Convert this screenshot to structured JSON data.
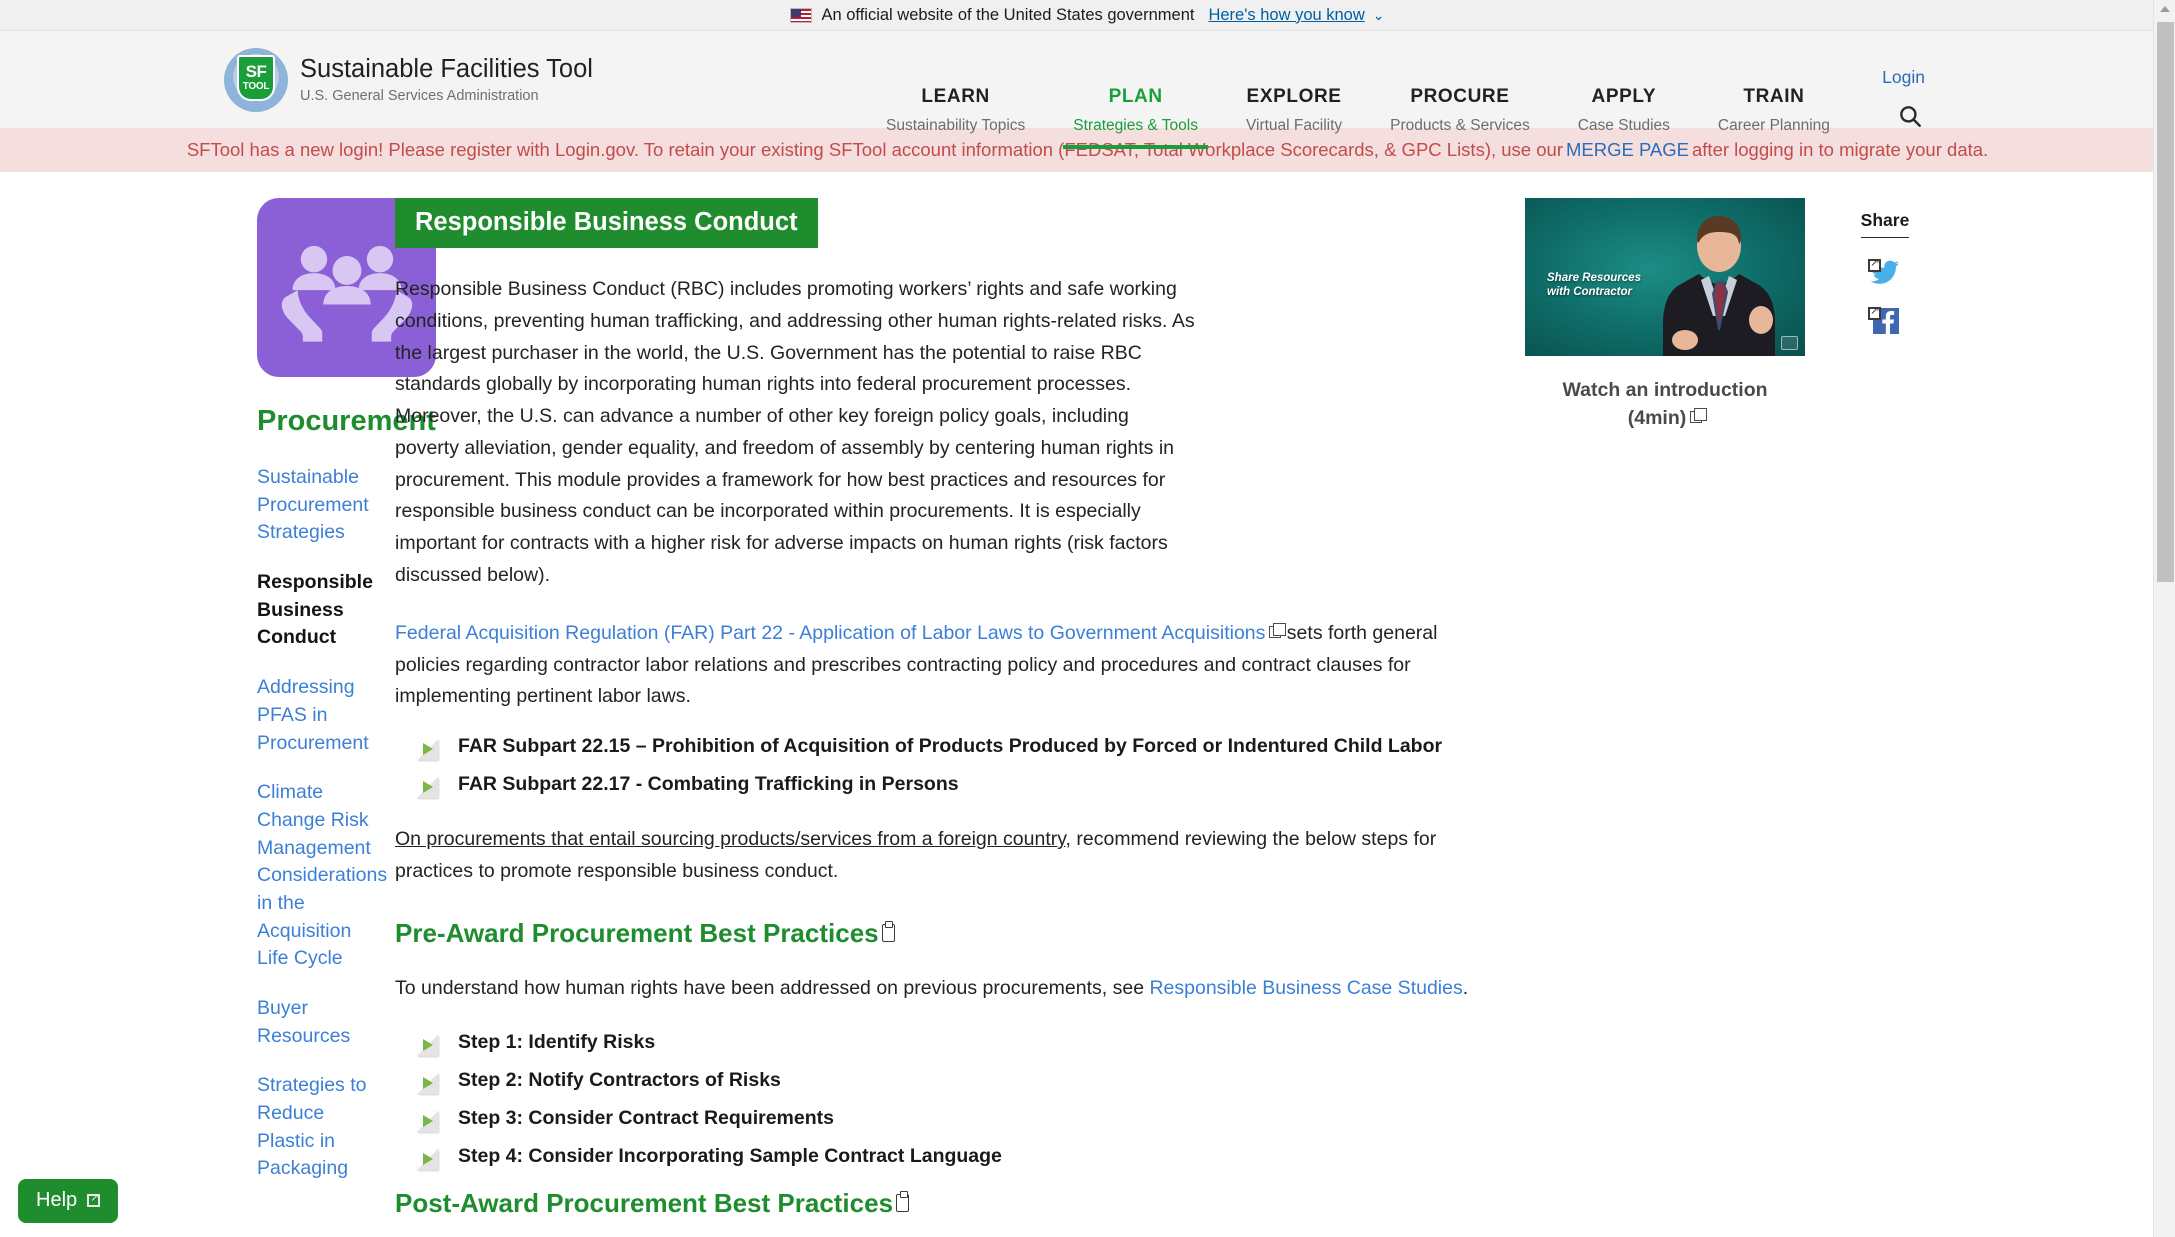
{
  "gov_banner": {
    "text": "An official website of the United States government",
    "link": "Here's how you know",
    "caret": "⌄"
  },
  "header": {
    "brand_title": "Sustainable Facilities Tool",
    "brand_sub": "U.S. General Services Administration",
    "logo_top": "SF",
    "logo_bottom": "TOOL",
    "login": "Login",
    "nav": [
      {
        "top": "LEARN",
        "bottom": "Sustainability Topics",
        "active": false
      },
      {
        "top": "PLAN",
        "bottom": "Strategies & Tools",
        "active": true
      },
      {
        "top": "EXPLORE",
        "bottom": "Virtual Facility",
        "active": false
      },
      {
        "top": "PROCURE",
        "bottom": "Products & Services",
        "active": false
      },
      {
        "top": "APPLY",
        "bottom": "Case Studies",
        "active": false
      },
      {
        "top": "TRAIN",
        "bottom": "Career Planning",
        "active": false
      }
    ]
  },
  "alert": {
    "before": "SFTool has a new login! Please register with Login.gov. To retain your existing SFTool account information (FEDSAT, Total Workplace Scorecards, & GPC Lists), use our",
    "link": "MERGE PAGE",
    "after": "after logging in to migrate your data."
  },
  "sidebar": {
    "title": "Procurement",
    "items": [
      {
        "label": "Sustainable Procurement Strategies",
        "current": false
      },
      {
        "label": "Responsible Business Conduct",
        "current": true
      },
      {
        "label": "Addressing PFAS in Procurement",
        "current": false
      },
      {
        "label": "Climate Change Risk Management Considerations in the Acquisition Life Cycle",
        "current": false
      },
      {
        "label": "Buyer Resources",
        "current": false
      },
      {
        "label": "Strategies to Reduce Plastic in Packaging",
        "current": false
      }
    ]
  },
  "main": {
    "title_banner": "Responsible Business Conduct",
    "intro_paragraph": "Responsible Business Conduct (RBC) includes promoting workers’ rights and safe working conditions, preventing human trafficking, and addressing other human rights-related risks. As the largest purchaser in the world, the U.S. Government has the potential to raise RBC standards globally by incorporating human rights into federal procurement processes. Moreover, the U.S. can advance a number of other key foreign policy goals, including poverty alleviation, gender equality, and freedom of assembly by centering human rights in procurement. This module provides a framework for how best practices and resources for responsible business conduct can be incorporated within procurements. It is especially important for contracts with a higher risk for adverse impacts on human rights (risk factors discussed below).",
    "far_link": "Federal Acquisition Regulation (FAR) Part 22 - Application of Labor Laws to Government Acquisitions",
    "far_paragraph_after": " sets forth general policies regarding contractor labor relations and prescribes contracting policy and procedures and contract clauses for implementing pertinent labor laws.",
    "far_subparts": [
      "FAR Subpart 22.15 – Prohibition of Acquisition of Products Produced by Forced or Indentured Child Labor",
      "FAR Subpart 22.17 - Combating Trafficking in Persons"
    ],
    "sourcing_underlined": "On procurements that entail sourcing products/services from a foreign country",
    "sourcing_rest": ", recommend reviewing the below steps for practices to promote responsible business conduct.",
    "pre_award_heading": "Pre-Award Procurement Best Practices",
    "case_studies_before": "To understand how human rights have been addressed on previous procurements, see ",
    "case_studies_link": "Responsible Business Case Studies",
    "case_studies_after": ".",
    "steps": [
      "Step 1: Identify Risks",
      "Step 2: Notify Contractors of Risks",
      "Step 3: Consider Contract Requirements",
      "Step 4: Consider Incorporating Sample Contract Language"
    ],
    "post_award_heading": "Post-Award Procurement Best Practices"
  },
  "video": {
    "thumb_caption": "Share Resources\nwith Contractor",
    "caption_line1": "Watch an introduction",
    "caption_line2": "(4min)"
  },
  "share": {
    "title": "Share",
    "twitter_label": "twitter-share",
    "facebook_label": "facebook-share"
  },
  "help": {
    "label": "Help"
  },
  "colors": {
    "brand_green": "#1f8c2e",
    "link_blue": "#3c7fd6",
    "alert_bg": "#f4dede",
    "alert_text": "#c44b4b",
    "module_purple": "#8b5fd6"
  }
}
